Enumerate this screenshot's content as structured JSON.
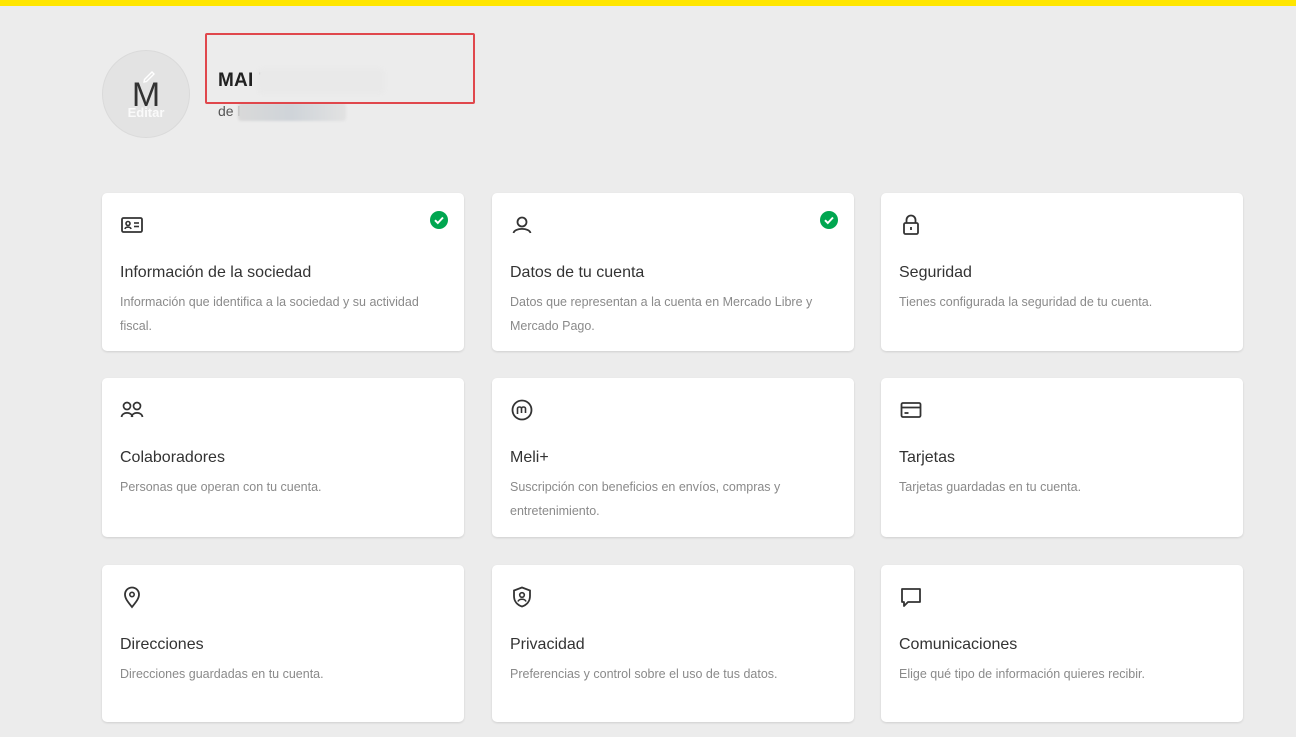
{
  "profile": {
    "avatar_letter": "M",
    "avatar_edit_label": "Editar",
    "name": "MAI                 TAS",
    "email": "de                 look.com"
  },
  "colors": {
    "topbar": "#ffe600",
    "check": "#00a650",
    "highlight": "#e0474c"
  },
  "cards": [
    {
      "icon": "id-card-icon",
      "title": "Información de la sociedad",
      "description": "Información que identifica a la sociedad y su actividad fiscal.",
      "verified": true
    },
    {
      "icon": "user-icon",
      "title": "Datos de tu cuenta",
      "description": "Datos que representan a la cuenta en Mercado Libre y Mercado Pago.",
      "verified": true
    },
    {
      "icon": "lock-icon",
      "title": "Seguridad",
      "description": "Tienes configurada la seguridad de tu cuenta.",
      "verified": false
    },
    {
      "icon": "users-icon",
      "title": "Colaboradores",
      "description": "Personas que operan con tu cuenta.",
      "verified": false
    },
    {
      "icon": "meli-plus-icon",
      "title": "Meli+",
      "description": "Suscripción con beneficios en envíos, compras y entretenimiento.",
      "verified": false
    },
    {
      "icon": "card-icon",
      "title": "Tarjetas",
      "description": "Tarjetas guardadas en tu cuenta.",
      "verified": false
    },
    {
      "icon": "location-pin-icon",
      "title": "Direcciones",
      "description": "Direcciones guardadas en tu cuenta.",
      "verified": false
    },
    {
      "icon": "privacy-shield-icon",
      "title": "Privacidad",
      "description": "Preferencias y control sobre el uso de tus datos.",
      "verified": false
    },
    {
      "icon": "chat-bubble-icon",
      "title": "Comunicaciones",
      "description": "Elige qué tipo de información quieres recibir.",
      "verified": false
    }
  ]
}
